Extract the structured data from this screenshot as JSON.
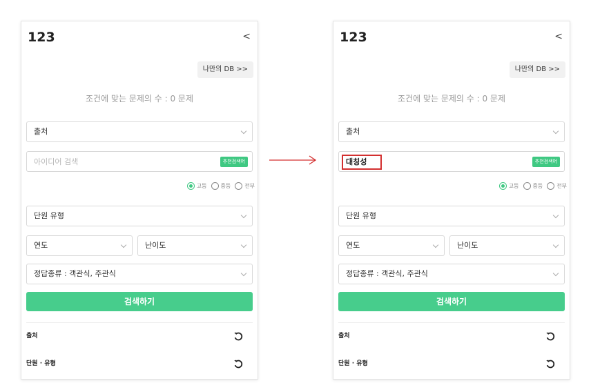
{
  "panels": [
    {
      "title": "123",
      "collapse_glyph": "<",
      "mydb_label": "나만의 DB >>",
      "count_text": "조건에 맞는 문제의 수 : 0 문제",
      "source_select": "출처",
      "search": {
        "value": "",
        "placeholder": "아이디어 검색",
        "reco_label": "추천검색어"
      },
      "radios": [
        {
          "label": "고등",
          "selected": true
        },
        {
          "label": "중등",
          "selected": false
        },
        {
          "label": "전부",
          "selected": false
        }
      ],
      "unit_select": "단원 유형",
      "year_select": "연도",
      "difficulty_select": "난이도",
      "answer_select": "정답종류 : 객관식, 주관식",
      "search_button": "검색하기",
      "filter_source": "출처",
      "filter_unit": "단원 · 유형"
    },
    {
      "title": "123",
      "collapse_glyph": "<",
      "mydb_label": "나만의 DB >>",
      "count_text": "조건에 맞는 문제의 수 : 0 문제",
      "source_select": "출처",
      "search": {
        "value": "대칭성",
        "placeholder": "아이디어 검색",
        "reco_label": "추천검색어"
      },
      "radios": [
        {
          "label": "고등",
          "selected": true
        },
        {
          "label": "중등",
          "selected": false
        },
        {
          "label": "전부",
          "selected": false
        }
      ],
      "unit_select": "단원 유형",
      "year_select": "연도",
      "difficulty_select": "난이도",
      "answer_select": "정답종류 : 객관식, 주관식",
      "search_button": "검색하기",
      "filter_source": "출처",
      "filter_unit": "단원 · 유형"
    }
  ],
  "colors": {
    "accent_green": "#47cd8c",
    "highlight_red": "#d32f2f",
    "arrow_red": "#d32f2f"
  },
  "icons": {
    "arrow": "right-arrow-icon",
    "reset": "reset-icon",
    "chevron": "chevron-down-icon"
  }
}
